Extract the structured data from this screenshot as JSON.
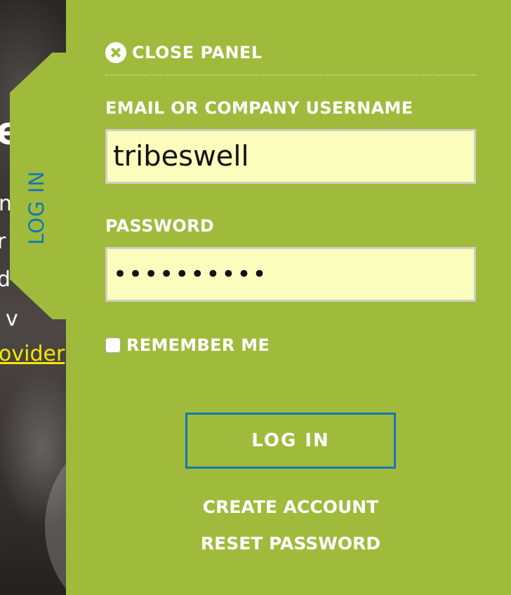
{
  "background": {
    "fragments": [
      "e",
      "n",
      "r",
      "d",
      "v",
      "ovider"
    ]
  },
  "tab": {
    "label": "LOG IN"
  },
  "panel": {
    "close_label": "CLOSE PANEL",
    "username": {
      "label": "EMAIL OR COMPANY USERNAME",
      "value": "tribeswell"
    },
    "password": {
      "label": "PASSWORD",
      "value": "••••••••••"
    },
    "remember_label": "REMEMBER ME",
    "login_button": "LOG IN",
    "create_account": "CREATE ACCOUNT",
    "reset_password": "RESET PASSWORD"
  },
  "colors": {
    "panel": "#a0ba3c",
    "accent_blue": "#1478b4",
    "input_bg": "#fbfebd",
    "link_yellow": "#f6e800"
  }
}
